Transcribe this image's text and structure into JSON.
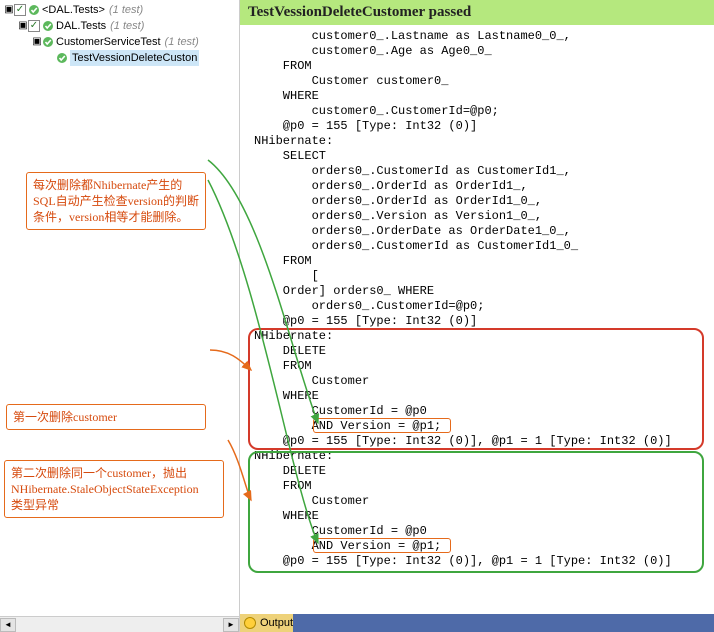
{
  "tree": {
    "root": {
      "name": "<DAL.Tests>",
      "count": "(1 test)"
    },
    "ns": {
      "name": "DAL.Tests",
      "count": "(1 test)"
    },
    "cls": {
      "name": "CustomerServiceTest",
      "count": "(1 test)"
    },
    "test": {
      "name": "TestVessionDeleteCuston"
    }
  },
  "annotations": {
    "a1": "每次删除都Nhibernate产生的SQL自动产生检查version的判断条件，version相等才能删除。",
    "a2": "第一次删除customer",
    "a3": "第二次删除同一个customer，抛出\nNHibernate.StaleObjectStateException\n类型异常"
  },
  "header": "TestVessionDeleteCustomer passed",
  "sql_lines": [
    "        customer0_.Lastname as Lastname0_0_,",
    "        customer0_.Age as Age0_0_",
    "    FROM",
    "        Customer customer0_",
    "    WHERE",
    "        customer0_.CustomerId=@p0;",
    "    @p0 = 155 [Type: Int32 (0)]",
    "NHibernate:",
    "    SELECT",
    "        orders0_.CustomerId as CustomerId1_,",
    "        orders0_.OrderId as OrderId1_,",
    "        orders0_.OrderId as OrderId1_0_,",
    "        orders0_.Version as Version1_0_,",
    "        orders0_.OrderDate as OrderDate1_0_,",
    "        orders0_.CustomerId as CustomerId1_0_",
    "    FROM",
    "        [",
    "    Order] orders0_ WHERE",
    "        orders0_.CustomerId=@p0;",
    "    @p0 = 155 [Type: Int32 (0)]",
    "NHibernate:",
    "    DELETE",
    "    FROM",
    "        Customer",
    "    WHERE",
    "        CustomerId = @p0",
    "        AND Version = @p1;",
    "    @p0 = 155 [Type: Int32 (0)], @p1 = 1 [Type: Int32 (0)]",
    "NHibernate:",
    "    DELETE",
    "    FROM",
    "        Customer",
    "    WHERE",
    "        CustomerId = @p0",
    "        AND Version = @p1;",
    "    @p0 = 155 [Type: Int32 (0)], @p1 = 1 [Type: Int32 (0)]"
  ],
  "output_tab": "Output",
  "scroll": {
    "left": "◄",
    "right": "►"
  }
}
